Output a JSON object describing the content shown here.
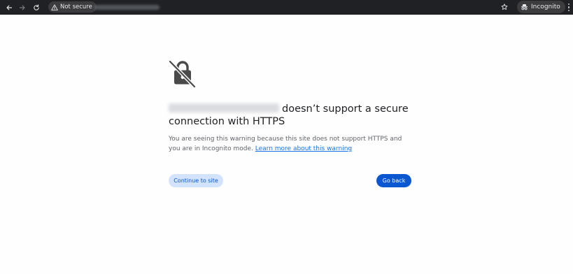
{
  "toolbar": {
    "security_chip_label": "Not secure",
    "incognito_label": "Incognito",
    "back_icon": "arrow-left-icon",
    "forward_icon": "arrow-right-icon",
    "reload_icon": "reload-icon",
    "bookmark_icon": "star-icon",
    "menu_icon": "kebab-menu-icon"
  },
  "interstitial": {
    "icon": "no-encryption-lock-icon",
    "title_suffix": "doesn’t support a secure connection with HTTPS",
    "description": "You are seeing this warning because this site does not support HTTPS and you are in Incognito mode.",
    "learn_more_link": "Learn more about this warning",
    "continue_button": "Continue to site",
    "back_button": "Go back"
  },
  "colors": {
    "toolbar_bg": "#202124",
    "chip_bg": "#3c3c3f",
    "link": "#1a73e8",
    "primary_button": "#0b57d0",
    "secondary_button": "#d3e3fd"
  }
}
